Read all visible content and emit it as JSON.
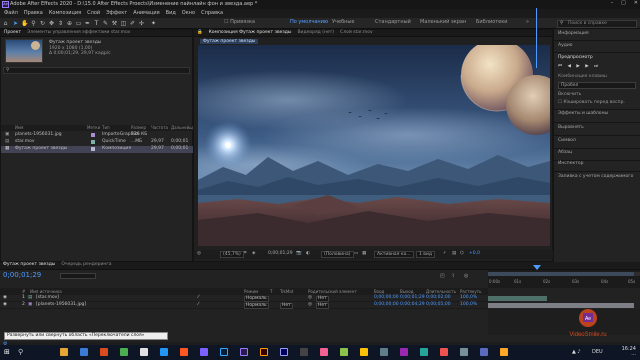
{
  "titlebar": {
    "app_badge": "Ae",
    "title": "Adobe After Effects 2020 - D:\\15.0 After Effects Proects\\Изменение пайнлайн фон и звезда.aep *"
  },
  "menu": [
    "Файл",
    "Правка",
    "Композиция",
    "Слой",
    "Эффект",
    "Анимация",
    "Вид",
    "Окно",
    "Справка"
  ],
  "toolbar": {
    "snap_label": "Привязка",
    "workspaces": [
      "По умолчанию",
      "Учебные",
      "Стандартный",
      "Маленький экран",
      "Библиотеки"
    ],
    "active_workspace": "По умолчанию",
    "search_placeholder": "Поиск в справке"
  },
  "project": {
    "tabs": [
      "Проект",
      "Элементы управления эффектами star.mov"
    ],
    "selected_name": "Футаж проект звезды",
    "selected_size": "1920 x 1080 (1,00)",
    "selected_duration": "Δ 0;00;01;29, 29,97 кадр/с",
    "columns": [
      "Имя",
      "Метки",
      "Тип",
      "Размер",
      "Частота",
      "Дальнейшее"
    ],
    "items": [
      {
        "name": "planets-1956031.jpg",
        "type": "ImporteGraphics",
        "size": "336 КБ",
        "fps": "",
        "dur": ""
      },
      {
        "name": "star.mov",
        "type": "QuickTime",
        "size": "...МБ",
        "fps": "29,97",
        "dur": "0;00;01"
      },
      {
        "name": "Футаж проект звезды",
        "type": "Композиция",
        "size": "",
        "fps": "29,97",
        "dur": "0;00;01"
      }
    ],
    "footer": "8 бит на канал"
  },
  "viewer": {
    "tabs": [
      "Композиция Футаж проект звезды",
      "Видеоряд (нет)",
      "Слой star.mov"
    ],
    "comp_tab_label": "Футаж проект звезды",
    "zoom": "(45,7%)",
    "timecode": "0;00;01;29",
    "resolution": "(Половина)",
    "camera": "Активная ка...",
    "views": "1 вид",
    "offset": "+0,0"
  },
  "right_panel": {
    "items": [
      "Информация",
      "Аудио",
      "Предпросмотр",
      "Комбинация клавиш",
      "Пробел",
      "Включить",
      "Кэшировать перед воспр.",
      "Эффекты и шаблоны",
      "Выровнять",
      "Символ",
      "Абзац",
      "Инспектор",
      "Заливка с учетом содержимого"
    ]
  },
  "timeline": {
    "tabs": [
      "Футаж проект звезды",
      "Очередь рендеринга"
    ],
    "timecode": "0;00;01;29",
    "columns": [
      "#",
      "Имя источника",
      "Режим",
      "T",
      "TrkMat",
      "Родительский элемент",
      "Вход",
      "Выход",
      "Длительность",
      "Растянуть"
    ],
    "layers": [
      {
        "num": "1",
        "name": "[star.mov]",
        "mode": "Нормаль",
        "trkmat": "",
        "parent": "Нет",
        "in": "0;00;00;00",
        "out": "0;00;01;29",
        "dur": "0;00;02;00",
        "stretch": "100,0%"
      },
      {
        "num": "2",
        "name": "[planets-1956031.jpg]",
        "mode": "Нормаль",
        "trkmat": "Нет",
        "parent": "Нет",
        "in": "0;00;00;00",
        "out": "0;00;04;29",
        "dur": "0;00;05;00",
        "stretch": "100,0%"
      }
    ],
    "ruler_ticks": [
      "0:00s",
      "01s",
      "02s",
      "03s",
      "04s",
      "05s"
    ],
    "tooltip": "Развернуть или свернуть область «Переключатели слоя»"
  },
  "taskbar": {
    "lang": "DEU",
    "time": "16:24",
    "date": "..."
  },
  "watermark": "VideoSmile.ru",
  "colors": {
    "accent": "#4e9bff",
    "bg": "#232323",
    "selection": "#434356",
    "video_bar": "#4f6f69",
    "image_bar": "#7e7f86"
  }
}
